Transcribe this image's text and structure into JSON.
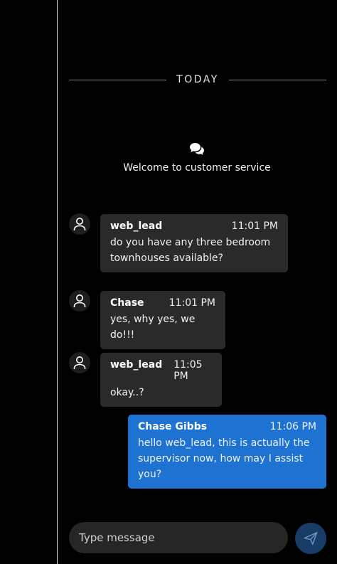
{
  "divider": {
    "label": "TODAY"
  },
  "welcome": {
    "icon": "chat-bubbles-icon",
    "text": "Welcome to customer service"
  },
  "messages": [
    {
      "sender": "web_lead",
      "time": "11:01 PM",
      "text": "do you have any three bedroom townhouses available?",
      "mine": false
    },
    {
      "sender": "Chase",
      "time": "11:01 PM",
      "text": "yes, why yes, we do!!!",
      "mine": false
    },
    {
      "sender": "web_lead",
      "time": "11:05 PM",
      "text": "okay..?",
      "mine": false
    },
    {
      "sender": "Chase Gibbs",
      "time": "11:06 PM",
      "text": "hello web_lead, this is actually the supervisor now, how may I assist you?",
      "mine": true
    }
  ],
  "composer": {
    "placeholder": "Type message",
    "value": ""
  },
  "send": {
    "icon": "send-icon"
  },
  "colors": {
    "bubble_incoming": "#2a2a2a",
    "bubble_outgoing": "#1e73d2",
    "send_button": "#173c66"
  }
}
